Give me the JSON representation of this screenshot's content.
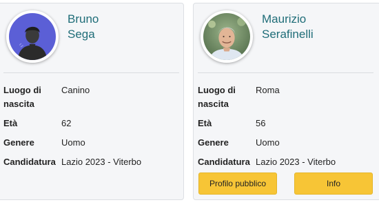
{
  "cards": [
    {
      "first_name": "Bruno",
      "last_name": "Sega",
      "avatar": "default-user-avatar-icon",
      "fields": [
        {
          "label": "Luogo di nascita",
          "value": "Canino"
        },
        {
          "label": "Età",
          "value": "62"
        },
        {
          "label": "Genere",
          "value": "Uomo"
        },
        {
          "label": "Candidatura",
          "value": "Lazio 2023 - Viterbo"
        }
      ]
    },
    {
      "first_name": "Maurizio",
      "last_name": "Serafinelli",
      "avatar": "candidate-photo",
      "fields": [
        {
          "label": "Luogo di nascita",
          "value": "Roma"
        },
        {
          "label": "Età",
          "value": "56"
        },
        {
          "label": "Genere",
          "value": "Uomo"
        },
        {
          "label": "Candidatura",
          "value": "Lazio 2023 - Viterbo"
        }
      ],
      "buttons": {
        "profile_label": "Profilo pubblico",
        "info_label": "Info"
      }
    }
  ],
  "colors": {
    "name": "#1f6d78",
    "button": "#f7c536",
    "avatar_bg": "#5b5fd6"
  }
}
